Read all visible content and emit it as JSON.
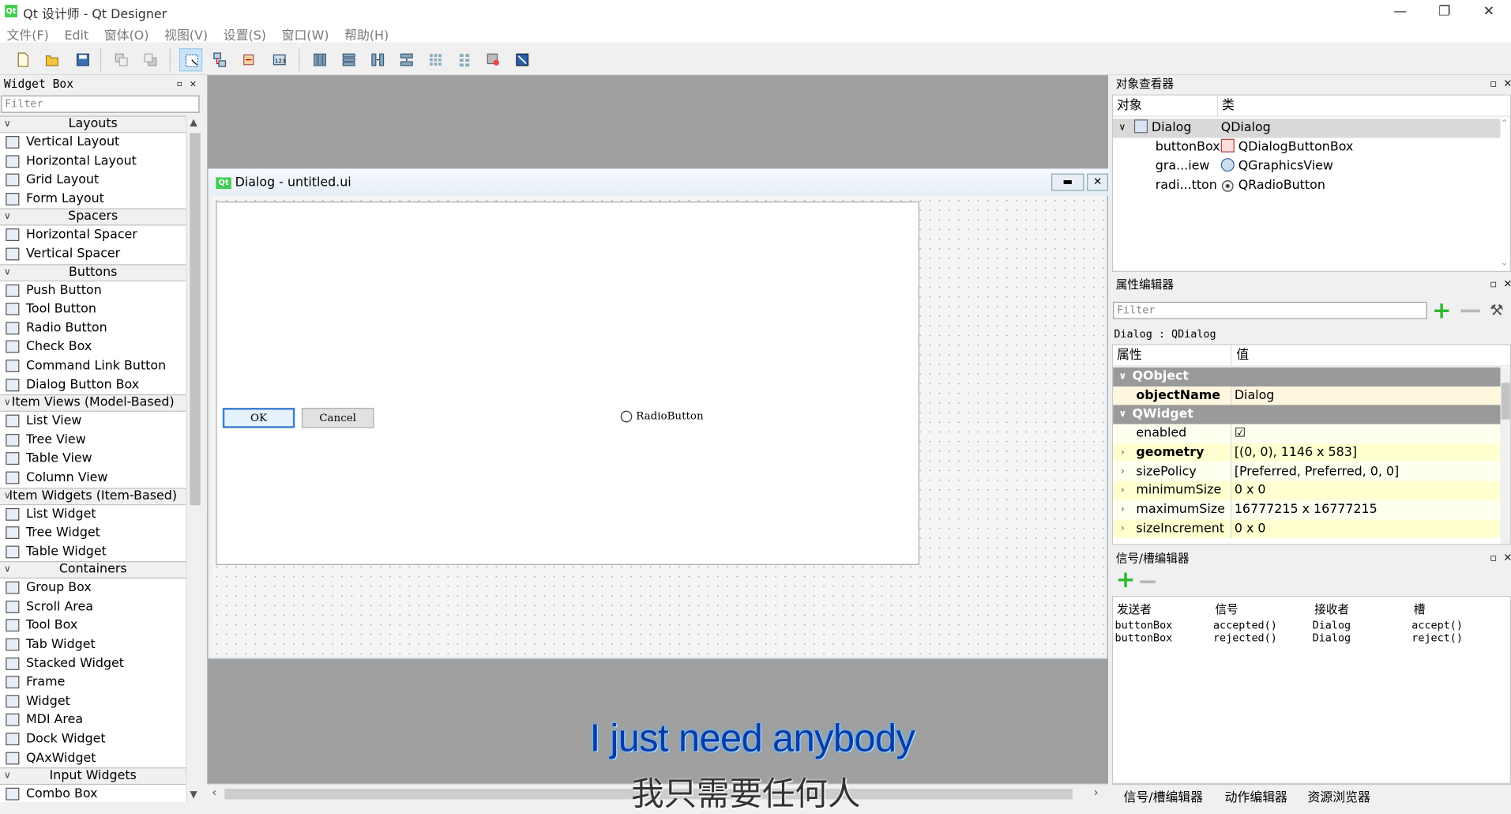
{
  "window": {
    "title": "Qt 设计师 - Qt Designer",
    "app_icon": "Qt",
    "minimize": "—",
    "restore": "❐",
    "close": "✕"
  },
  "menu": [
    "文件(F)",
    "Edit",
    "窗体(O)",
    "视图(V)",
    "设置(S)",
    "窗口(W)",
    "帮助(H)"
  ],
  "widget_box": {
    "title": "Widget Box",
    "filter_placeholder": "Filter",
    "categories": [
      {
        "label": "Layouts",
        "items": [
          "Vertical Layout",
          "Horizontal Layout",
          "Grid Layout",
          "Form Layout"
        ]
      },
      {
        "label": "Spacers",
        "items": [
          "Horizontal Spacer",
          "Vertical Spacer"
        ]
      },
      {
        "label": "Buttons",
        "items": [
          "Push Button",
          "Tool Button",
          "Radio Button",
          "Check Box",
          "Command Link Button",
          "Dialog Button Box"
        ]
      },
      {
        "label": "Item Views (Model-Based)",
        "items": [
          "List View",
          "Tree View",
          "Table View",
          "Column View"
        ]
      },
      {
        "label": "Item Widgets (Item-Based)",
        "items": [
          "List Widget",
          "Tree Widget",
          "Table Widget"
        ]
      },
      {
        "label": "Containers",
        "items": [
          "Group Box",
          "Scroll Area",
          "Tool Box",
          "Tab Widget",
          "Stacked Widget",
          "Frame",
          "Widget",
          "MDI Area",
          "Dock Widget",
          "QAxWidget"
        ]
      },
      {
        "label": "Input Widgets",
        "items": [
          "Combo Box"
        ]
      }
    ]
  },
  "dialog": {
    "title": "Dialog - untitled.ui",
    "icon": "Qt",
    "ok": "OK",
    "cancel": "Cancel",
    "radio": "RadioButton"
  },
  "object_inspector": {
    "title": "对象查看器",
    "col_object": "对象",
    "col_class": "类",
    "rows": [
      {
        "object": "Dialog",
        "class": "QDialog"
      },
      {
        "object": "buttonBox",
        "class": "QDialogButtonBox"
      },
      {
        "object": "gra...iew",
        "class": "QGraphicsView"
      },
      {
        "object": "radi...tton",
        "class": "QRadioButton"
      }
    ]
  },
  "property_editor": {
    "title": "属性编辑器",
    "filter_placeholder": "Filter",
    "context": "Dialog : QDialog",
    "col_property": "属性",
    "col_value": "值",
    "rows": [
      {
        "name": "QObject",
        "value": "",
        "type": "group"
      },
      {
        "name": "objectName",
        "value": "Dialog",
        "type": "y1",
        "bold": true
      },
      {
        "name": "QWidget",
        "value": "",
        "type": "group"
      },
      {
        "name": "enabled",
        "value": "☑",
        "type": "y3"
      },
      {
        "name": "geometry",
        "value": "[(0, 0), 1146 x 583]",
        "type": "y2",
        "bold": true
      },
      {
        "name": "sizePolicy",
        "value": "[Preferred, Preferred, 0, 0]",
        "type": "y3"
      },
      {
        "name": "minimumSize",
        "value": "0 x 0",
        "type": "y2"
      },
      {
        "name": "maximumSize",
        "value": "16777215 x 16777215",
        "type": "y3"
      },
      {
        "name": "sizeIncrement",
        "value": "0 x 0",
        "type": "y2"
      }
    ]
  },
  "signal_slot": {
    "title": "信号/槽编辑器",
    "headers": [
      "发送者",
      "信号",
      "接收者",
      "槽"
    ],
    "rows": [
      [
        "buttonBox",
        "accepted()",
        "Dialog",
        "accept()"
      ],
      [
        "buttonBox",
        "rejected()",
        "Dialog",
        "reject()"
      ]
    ]
  },
  "bottom_tabs": [
    "信号/槽编辑器",
    "动作编辑器",
    "资源浏览器"
  ],
  "subtitles": {
    "en": "I just need anybody",
    "zh": "我只需要任何人"
  }
}
